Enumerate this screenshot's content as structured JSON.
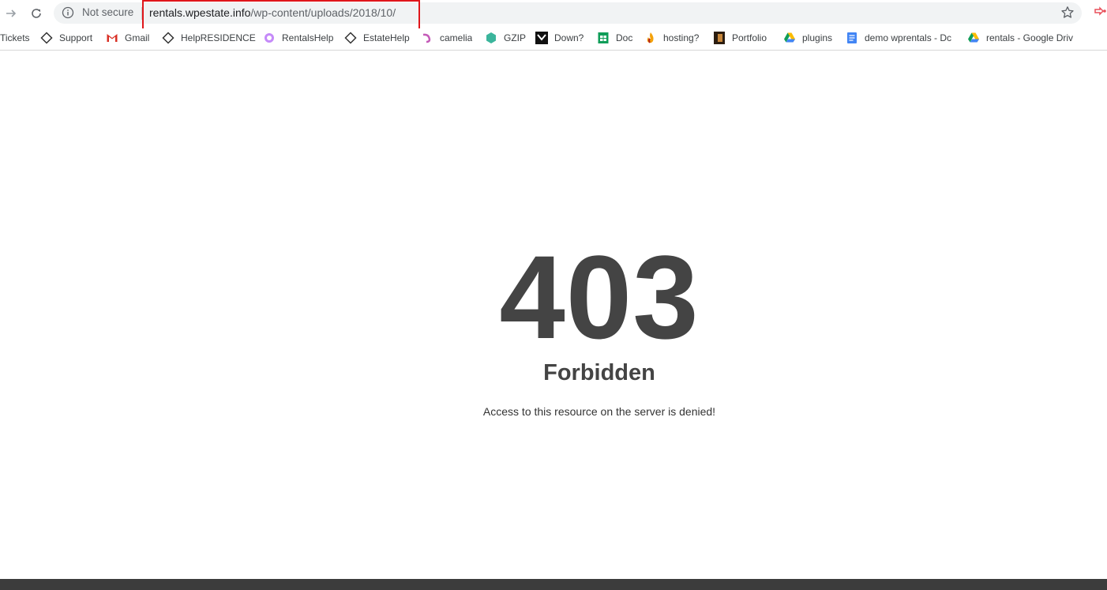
{
  "browser": {
    "security_label": "Not secure",
    "url_host": "rentals.wpestate.info",
    "url_path": "/wp-content/uploads/2018/10/"
  },
  "bookmarks": [
    {
      "label": "Tickets",
      "icon": "none"
    },
    {
      "label": "Support",
      "icon": "diamond-code-icon"
    },
    {
      "label": "Gmail",
      "icon": "gmail-icon"
    },
    {
      "label": "HelpRESIDENCE",
      "icon": "diamond-code-icon"
    },
    {
      "label": "RentalsHelp",
      "icon": "purple-circle-icon"
    },
    {
      "label": "EstateHelp",
      "icon": "diamond-code-icon"
    },
    {
      "label": "camelia",
      "icon": "pink-swirl-icon"
    },
    {
      "label": "GZIP",
      "icon": "teal-hexagon-icon"
    },
    {
      "label": "Down?",
      "icon": "black-square-icon"
    },
    {
      "label": "Doc",
      "icon": "green-sheet-icon"
    },
    {
      "label": "hosting?",
      "icon": "flame-icon"
    },
    {
      "label": "Portfolio",
      "icon": "portfolio-icon"
    },
    {
      "label": "plugins",
      "icon": "google-drive-icon"
    },
    {
      "label": "demo wprentals - Dc",
      "icon": "google-doc-icon"
    },
    {
      "label": "rentals - Google Driv",
      "icon": "google-drive-icon"
    }
  ],
  "error": {
    "code": "403",
    "title": "Forbidden",
    "message": "Access to this resource on the server is denied!"
  },
  "colors": {
    "highlight": "#e0161b",
    "error_text": "#444444",
    "bottom_bar": "#3c3c3c"
  }
}
